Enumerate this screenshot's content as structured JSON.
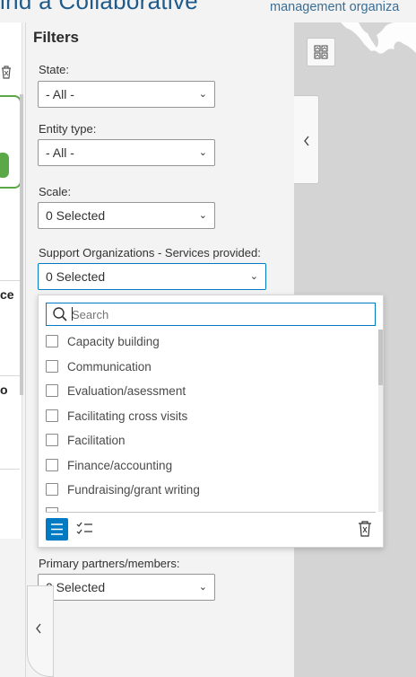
{
  "header": {
    "title": "ind a Collaborative",
    "subtitle": "management organiza"
  },
  "left_list": {
    "fragment_1": "ce",
    "fragment_2": "o"
  },
  "filters": {
    "title": "Filters",
    "state": {
      "label": "State:",
      "value": "- All -"
    },
    "entity_type": {
      "label": "Entity type:",
      "value": "- All -"
    },
    "scale": {
      "label": "Scale:",
      "value": "0 Selected"
    },
    "support_services": {
      "label": "Support Organizations - Services provided:",
      "value": "0 Selected"
    },
    "primary_partners": {
      "label": "Primary partners/members:",
      "value": "0 Selected"
    }
  },
  "dropdown": {
    "search_placeholder": "Search",
    "options": [
      "Capacity building",
      "Communication",
      "Evaluation/asessment",
      "Facilitating cross visits",
      "Facilitation",
      "Finance/accounting",
      "Fundraising/grant writing"
    ]
  },
  "icons": {
    "chevron": "chevron-down-icon",
    "search": "search-icon",
    "list": "list-icon",
    "checklist": "checklist-icon",
    "trash": "trash-icon",
    "basemap": "basemap-gallery-icon",
    "collapse": "chevron-left-icon"
  },
  "colors": {
    "accent": "#007ac2",
    "header_text": "#1e5a8a",
    "card_border": "#5aa848"
  }
}
